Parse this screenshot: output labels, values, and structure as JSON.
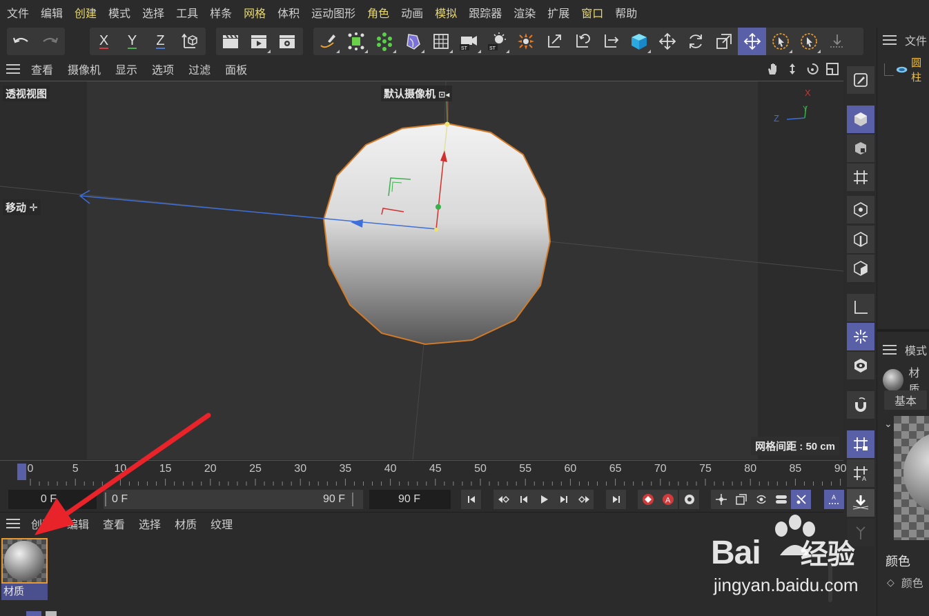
{
  "menubar": [
    {
      "label": "文件",
      "hl": false
    },
    {
      "label": "编辑",
      "hl": false
    },
    {
      "label": "创建",
      "hl": true
    },
    {
      "label": "模式",
      "hl": false
    },
    {
      "label": "选择",
      "hl": false
    },
    {
      "label": "工具",
      "hl": false
    },
    {
      "label": "样条",
      "hl": false
    },
    {
      "label": "网格",
      "hl": true
    },
    {
      "label": "体积",
      "hl": false
    },
    {
      "label": "运动图形",
      "hl": false
    },
    {
      "label": "角色",
      "hl": true
    },
    {
      "label": "动画",
      "hl": false
    },
    {
      "label": "模拟",
      "hl": true
    },
    {
      "label": "跟踪器",
      "hl": false
    },
    {
      "label": "渲染",
      "hl": false
    },
    {
      "label": "扩展",
      "hl": false
    },
    {
      "label": "窗口",
      "hl": true
    },
    {
      "label": "帮助",
      "hl": false
    }
  ],
  "toolbar": {
    "axis_x": "X",
    "axis_y": "Y",
    "axis_z": "Z",
    "st_label": "ST"
  },
  "viewport_menu": [
    "查看",
    "摄像机",
    "显示",
    "选项",
    "过滤",
    "面板"
  ],
  "viewport": {
    "view_name": "透视视图",
    "camera_label": "默认摄像机",
    "tool_label": "移动",
    "grid_distance": "网格间距 : 50 cm",
    "axis_x": "X",
    "axis_y": "Y",
    "axis_z": "Z"
  },
  "timeline": {
    "ticks": [
      "0",
      "5",
      "10",
      "15",
      "20",
      "25",
      "30",
      "35",
      "40",
      "45",
      "50",
      "55",
      "60",
      "65",
      "70",
      "75",
      "80",
      "85",
      "90"
    ],
    "current_frame": "0 F",
    "range_start": "0 F",
    "range_end": "90 F",
    "end_frame": "90 F"
  },
  "material_menu": [
    "创建",
    "编辑",
    "查看",
    "选择",
    "材质",
    "纹理"
  ],
  "material": {
    "name": "材质"
  },
  "right_panel": {
    "top_menu": "文件",
    "object_name": "圆柱",
    "attr_menu": "模式",
    "attr_title": "材质",
    "tab_basic": "基本",
    "section_color": "颜色",
    "prop_color": "颜色"
  },
  "watermark": {
    "brand": "Bai",
    "brand2": "经验",
    "url": "jingyan.baidu.com"
  },
  "colors": {
    "accent": "#5960a8",
    "highlight_menu": "#e8d86a",
    "selection_orange": "#e89a32",
    "annotation_arrow": "#e8232a"
  }
}
